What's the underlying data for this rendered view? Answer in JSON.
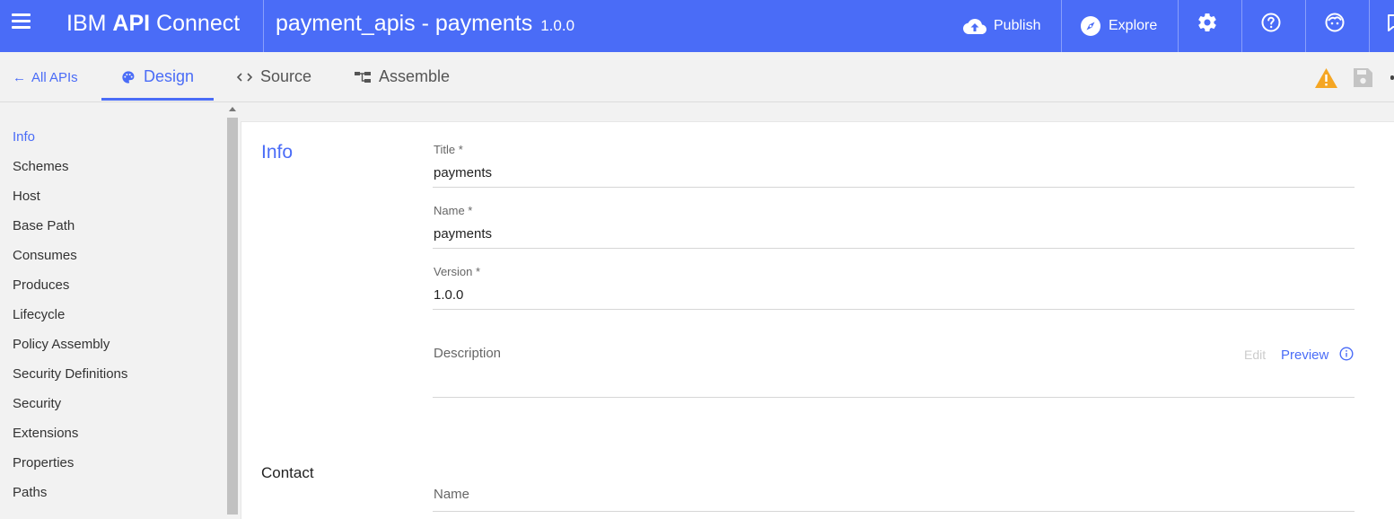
{
  "header": {
    "brand_prefix": "IBM",
    "brand_bold": "API",
    "brand_suffix": "Connect",
    "api_title": "payment_apis - payments",
    "api_version": "1.0.0",
    "publish_label": "Publish",
    "explore_label": "Explore"
  },
  "subnav": {
    "back_label": "All APIs",
    "tabs": [
      {
        "label": "Design",
        "icon": "palette-icon",
        "active": true
      },
      {
        "label": "Source",
        "icon": "code-icon",
        "active": false
      },
      {
        "label": "Assemble",
        "icon": "assemble-icon",
        "active": false
      }
    ]
  },
  "sidebar": {
    "items": [
      {
        "label": "Info",
        "active": true
      },
      {
        "label": "Schemes"
      },
      {
        "label": "Host"
      },
      {
        "label": "Base Path"
      },
      {
        "label": "Consumes"
      },
      {
        "label": "Produces"
      },
      {
        "label": "Lifecycle"
      },
      {
        "label": "Policy Assembly"
      },
      {
        "label": "Security Definitions"
      },
      {
        "label": "Security"
      },
      {
        "label": "Extensions"
      },
      {
        "label": "Properties"
      },
      {
        "label": "Paths"
      }
    ]
  },
  "info": {
    "section_title": "Info",
    "title_label": "Title *",
    "title_value": "payments",
    "name_label": "Name *",
    "name_value": "payments",
    "version_label": "Version *",
    "version_value": "1.0.0",
    "description_label": "Description",
    "edit_label": "Edit",
    "preview_label": "Preview"
  },
  "contact": {
    "section_title": "Contact",
    "name_label": "Name"
  },
  "colors": {
    "accent": "#4a6cf7",
    "warning": "#f5a623"
  }
}
